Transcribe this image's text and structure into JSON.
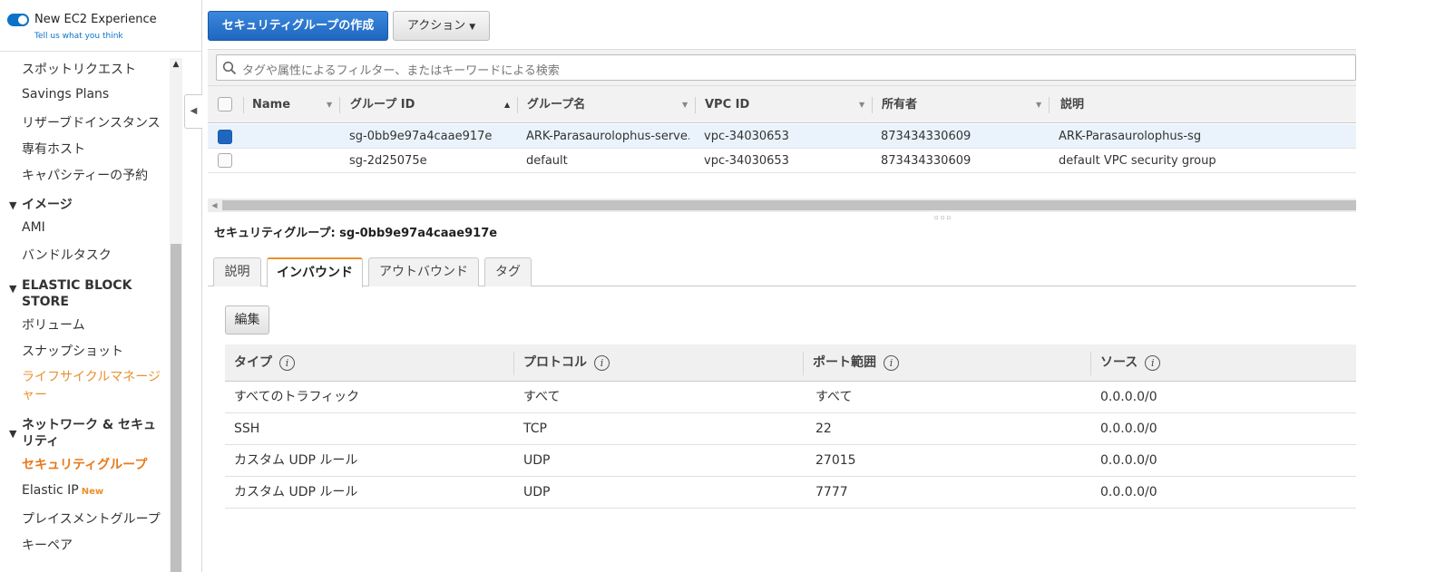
{
  "experience_toggle": {
    "label": "New EC2 Experience",
    "link": "Tell us what you think",
    "enabled": true
  },
  "sidebar": {
    "items": [
      {
        "label": "スポットリクエスト"
      },
      {
        "label": "Savings Plans"
      },
      {
        "label": "リザーブドインスタンス"
      },
      {
        "label": "専有ホスト"
      },
      {
        "label": "キャパシティーの予約"
      }
    ],
    "sections": [
      {
        "title": "イメージ",
        "items": [
          {
            "label": "AMI"
          },
          {
            "label": "バンドルタスク"
          }
        ]
      },
      {
        "title": "ELASTIC BLOCK STORE",
        "items": [
          {
            "label": "ボリューム"
          },
          {
            "label": "スナップショット"
          },
          {
            "label": "ライフサイクルマネージャー"
          }
        ]
      },
      {
        "title": "ネットワーク & セキュリティ",
        "items": [
          {
            "label": "セキュリティグループ",
            "active": true
          },
          {
            "label": "Elastic IP",
            "badge": "New"
          },
          {
            "label": "プレイスメントグループ"
          },
          {
            "label": "キーペア"
          }
        ]
      }
    ]
  },
  "toolbar": {
    "create_label": "セキュリティグループの作成",
    "action_label": "アクション"
  },
  "filter": {
    "placeholder": "タグや属性によるフィルター、またはキーワードによる検索"
  },
  "resource_table": {
    "columns": [
      "Name",
      "グループ ID",
      "グループ名",
      "VPC ID",
      "所有者",
      "説明"
    ],
    "sorted_column": "グループ ID",
    "rows": [
      {
        "selected": true,
        "name": "",
        "group_id": "sg-0bb9e97a4caae917e",
        "group_name": "ARK-Parasaurolophus-serve...",
        "vpc_id": "vpc-34030653",
        "owner": "873434330609",
        "description": "ARK-Parasaurolophus-sg"
      },
      {
        "selected": false,
        "name": "",
        "group_id": "sg-2d25075e",
        "group_name": "default",
        "vpc_id": "vpc-34030653",
        "owner": "873434330609",
        "description": "default VPC security group"
      }
    ]
  },
  "details": {
    "title": "セキュリティグループ: sg-0bb9e97a4caae917e",
    "tabs": [
      {
        "label": "説明",
        "active": false
      },
      {
        "label": "インバウンド",
        "active": true
      },
      {
        "label": "アウトバウンド",
        "active": false
      },
      {
        "label": "タグ",
        "active": false
      }
    ],
    "edit_label": "編集",
    "info_glyph": "i",
    "rules_columns": [
      "タイプ",
      "プロトコル",
      "ポート範囲",
      "ソース"
    ],
    "rules": [
      {
        "type": "すべてのトラフィック",
        "protocol": "すべて",
        "port": "すべて",
        "source": "0.0.0.0/0"
      },
      {
        "type": "SSH",
        "protocol": "TCP",
        "port": "22",
        "source": "0.0.0.0/0"
      },
      {
        "type": "カスタム UDP ルール",
        "protocol": "UDP",
        "port": "27015",
        "source": "0.0.0.0/0"
      },
      {
        "type": "カスタム UDP ルール",
        "protocol": "UDP",
        "port": "7777",
        "source": "0.0.0.0/0"
      }
    ]
  },
  "colors": {
    "primary_button": "#2c78d2",
    "active_nav": "#e8791a",
    "active_tab_accent": "#e8912d",
    "selected_row": "#eaf3fc"
  }
}
